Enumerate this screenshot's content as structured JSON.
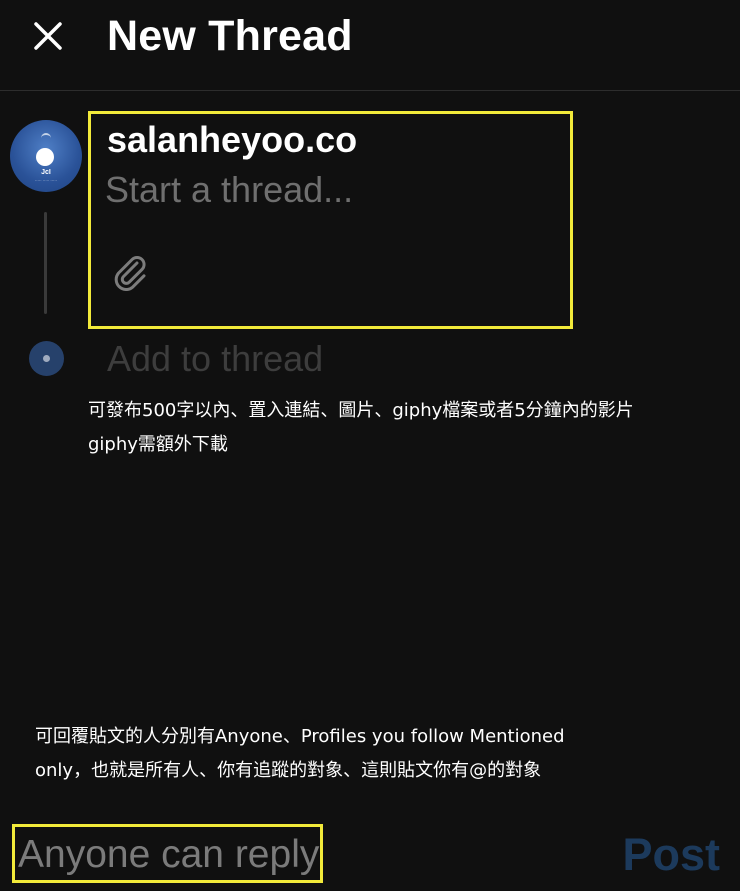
{
  "header": {
    "close_icon": "close-icon",
    "title": "New Thread"
  },
  "compose": {
    "username": "salanheyoo.co",
    "placeholder": "Start a thread...",
    "input_value": "",
    "attach_icon": "paperclip-icon",
    "avatar_text": "JcI",
    "add_to_thread": "Add to thread"
  },
  "annotations": {
    "note1": [
      "可發布500字以內、置入連結、圖片、giphy檔案或者5分鐘內的影片",
      "giphy需額外下載"
    ],
    "note2": [
      "可回覆貼文的人分別有Anyone、Profiles you follow Mentioned",
      "only，也就是所有人、你有追蹤的對象、這則貼文你有@的對象"
    ]
  },
  "footer": {
    "reply_setting": "Anyone can reply",
    "post_label": "Post"
  },
  "colors": {
    "background": "#101010",
    "highlight": "#f2ea3a",
    "post_disabled": "#1c3a5c",
    "placeholder": "#6f6f6f"
  }
}
